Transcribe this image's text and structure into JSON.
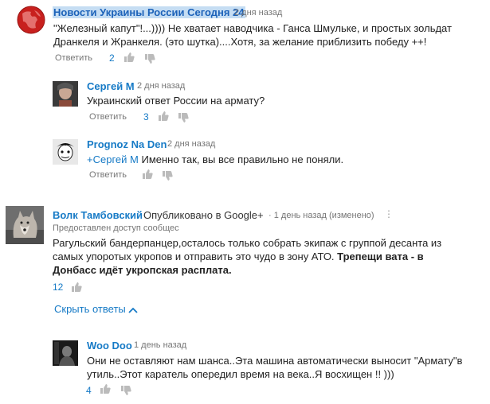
{
  "comments": [
    {
      "author": "Новости Украины России Сегодня 24",
      "time": "2 дня назад",
      "text": "\"Железный капут\"!...)))) Не хватает наводчика - Ганса Шмульке, и простых зольдат Дранкеля и Жранкеля. (это шутка)....Хотя, за желание приблизить победу ++!",
      "reply_label": "Ответить",
      "likes": "2"
    },
    {
      "author": "Сергей М",
      "time": "2 дня назад",
      "text": "Украинский ответ России на армату?",
      "reply_label": "Ответить",
      "likes": "3"
    },
    {
      "author": "Prognoz Na Den",
      "time": "2 дня назад",
      "mention": "+Сергей М",
      "text": "Именно так, вы все правильно не поняли.",
      "reply_label": "Ответить",
      "likes": ""
    },
    {
      "author": "Волк Тамбовский",
      "published": "Опубликовано в Google+",
      "time": "1 день назад (изменено)",
      "access": "Предоставлен доступ сообщес",
      "text": "Рагульский бандерпанцер,осталось только собрать экипаж с группой десанта из самых упоротых укропов и отправить это чудо в зону АТО.",
      "text_bold": "Трепещи вата - в Донбасс идёт укропская расплата.",
      "likes": "12",
      "hide_replies": "Скрыть ответы"
    },
    {
      "author": "Woo Doo",
      "time": "1 день назад",
      "text": "Они не оставляют нам шанса..Эта машина автоматически выносит \"Армату\"в утиль..Этот каратель опередил время на века..Я восхищен !! )))",
      "likes": "4"
    }
  ],
  "colors": {
    "link": "#167ac6",
    "highlight": "#c5ddf3",
    "muted": "#767676"
  }
}
